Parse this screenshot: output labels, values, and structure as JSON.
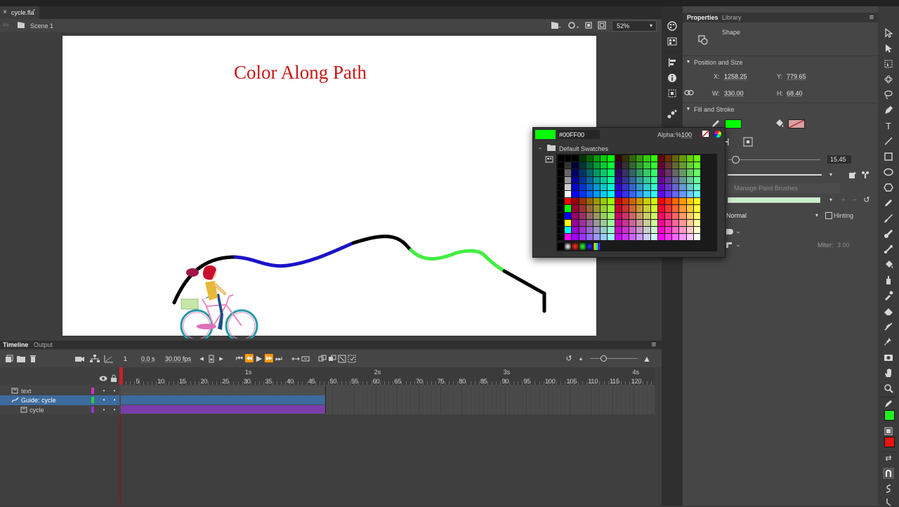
{
  "document": {
    "tab_name": "cycle.fla",
    "tab_mark": "*",
    "close_glyph": "×",
    "scene_label": "Scene 1",
    "zoom": "52%"
  },
  "stage": {
    "title": "Color Along Path",
    "path_colors": {
      "black": "#000000",
      "blue": "#1010c8",
      "green": "#44ee44"
    }
  },
  "right_panel": {
    "tabs": [
      "Properties",
      "Library"
    ],
    "object_type": "Shape",
    "position_section": "Position and Size",
    "fill_section": "Fill and Stroke",
    "x_label": "X:",
    "x_value": "1258.25",
    "y_label": "Y:",
    "y_value": "779.65",
    "w_label": "W:",
    "w_value": "330.00",
    "h_label": "H:",
    "h_value": "68.40",
    "stroke_width": "15.45",
    "manage_brushes": "Manage Paint Brushes",
    "scale_mode": "Normal",
    "hinting": "Hinting",
    "miter_label": "Miter:",
    "miter_value": "3.00",
    "stroke_color": "#00ff00"
  },
  "swatches": {
    "hex_value": "#00FF00",
    "alpha_label": "Alpha:",
    "alpha_unit": "%",
    "alpha_value": "100",
    "group_name": "Default Swatches"
  },
  "timeline": {
    "tabs": [
      "Timeline",
      "Output"
    ],
    "current_frame": "1",
    "time": "0.0 s",
    "fps": "30.00 fps",
    "seconds_marks": [
      "1s",
      "2s",
      "3s",
      "4s"
    ],
    "frame_numbers": [
      "1",
      "5",
      "10",
      "15",
      "20",
      "25",
      "30",
      "35",
      "40",
      "45",
      "50",
      "55",
      "60",
      "65",
      "70",
      "75",
      "80",
      "85",
      "90",
      "95",
      "100",
      "105",
      "110",
      "115",
      "120"
    ],
    "layers": [
      {
        "name": "text",
        "color": "#cc33cc"
      },
      {
        "name": "Guide: cycle",
        "color": "#33cc33"
      },
      {
        "name": "cycle",
        "color": "#9933cc"
      }
    ]
  },
  "tools": {
    "fill_color": "#22ee22",
    "red_swatch": "#ee1111"
  }
}
